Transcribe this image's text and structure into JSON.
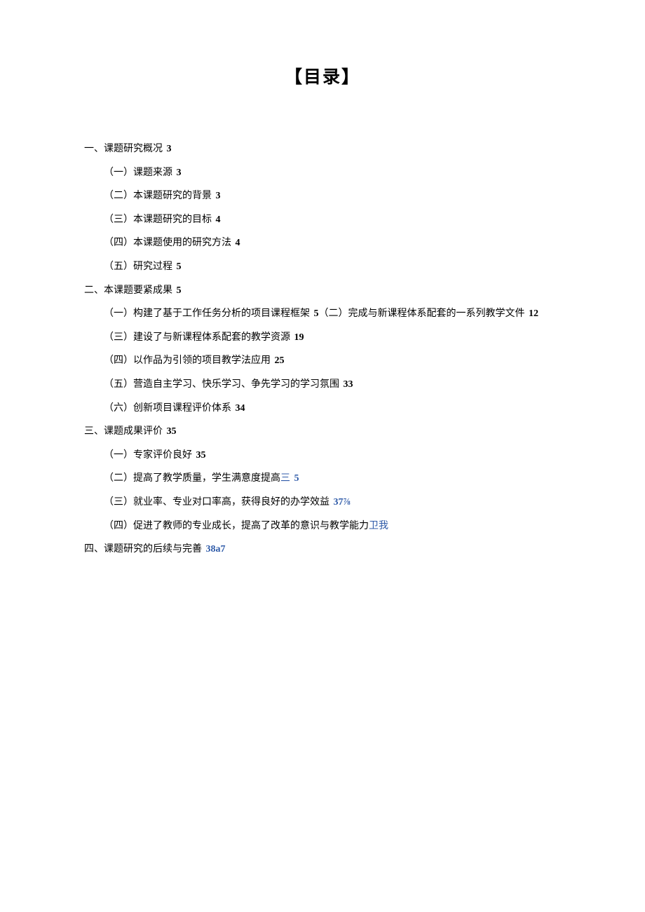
{
  "title": "【目录】",
  "toc": {
    "s1": {
      "text": "一、课题研究概况 ",
      "page": "3"
    },
    "s1_1": {
      "text": "（一）课题来源 ",
      "page": "3"
    },
    "s1_2": {
      "text": "（二）本课题研究的背景 ",
      "page": "3"
    },
    "s1_3": {
      "text": "（三）本课题研究的目标 ",
      "page": "4"
    },
    "s1_4": {
      "text": "（四）本课题使用的研究方法 ",
      "page": "4"
    },
    "s1_5": {
      "text": "（五）研究过程 ",
      "page": "5"
    },
    "s2": {
      "text": "二、本课题要紧成果 ",
      "page": "5"
    },
    "s2_1a": {
      "text": "（一）构建了基于工作任务分析的项目课程框架 ",
      "page": "5"
    },
    "s2_1b": {
      "text": "（二）完成与新课程体系配套的一系列教学文件 ",
      "page": "12"
    },
    "s2_3": {
      "text": "（三）建设了与新课程体系配套的教学资源 ",
      "page": "19"
    },
    "s2_4": {
      "text": "（四）以作品为引领的项目教学法应用 ",
      "page": "25"
    },
    "s2_5": {
      "text": "（五）营造自主学习、快乐学习、争先学习的学习氛围 ",
      "page": "33"
    },
    "s2_6": {
      "text": "（六）创新项目课程评价体系 ",
      "page": "34"
    },
    "s3": {
      "text": "三、课题成果评价 ",
      "page": "35"
    },
    "s3_1": {
      "text": "（一）专家评价良好 ",
      "page": "35"
    },
    "s3_2": {
      "text": "（二）提高了教学质量，学生满意度提高",
      "blue_pre": "三 ",
      "page": "5"
    },
    "s3_3": {
      "text": "（三）就业率、专业对口率高，获得良好的办学效益 ",
      "page": "37⅞"
    },
    "s3_4": {
      "text": "（四）促进了教师的专业成长，提高了改革的意识与教学能力",
      "blue": "卫我"
    },
    "s4": {
      "text": "四、课题研究的后续与完善 ",
      "page": "38a7"
    }
  }
}
